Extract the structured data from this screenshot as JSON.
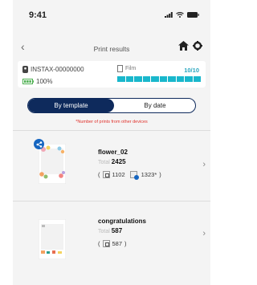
{
  "status_bar": {
    "time": "9:41"
  },
  "nav": {
    "title": "Print results"
  },
  "device": {
    "serial": "INSTAX-00000000",
    "battery": "100%",
    "film_label": "Film",
    "film_count": "10/10",
    "film_level": 1.0
  },
  "tabs": [
    {
      "label": "By template",
      "active": true
    },
    {
      "label": "By date",
      "active": false
    }
  ],
  "note": "*Number of prints from other devices",
  "templates": [
    {
      "name": "flower_02",
      "total_label": "Total",
      "total": "2425",
      "own_prints": "1102",
      "shared_prints": "1323*",
      "shared": true
    },
    {
      "name": "congratulations",
      "total_label": "Total",
      "total": "587",
      "own_prints": "587",
      "shared": false
    }
  ],
  "colors": {
    "navy": "#0e2a5c",
    "teal": "#19b7cc",
    "note_red": "#e0312b",
    "badge_blue": "#1565c0"
  }
}
